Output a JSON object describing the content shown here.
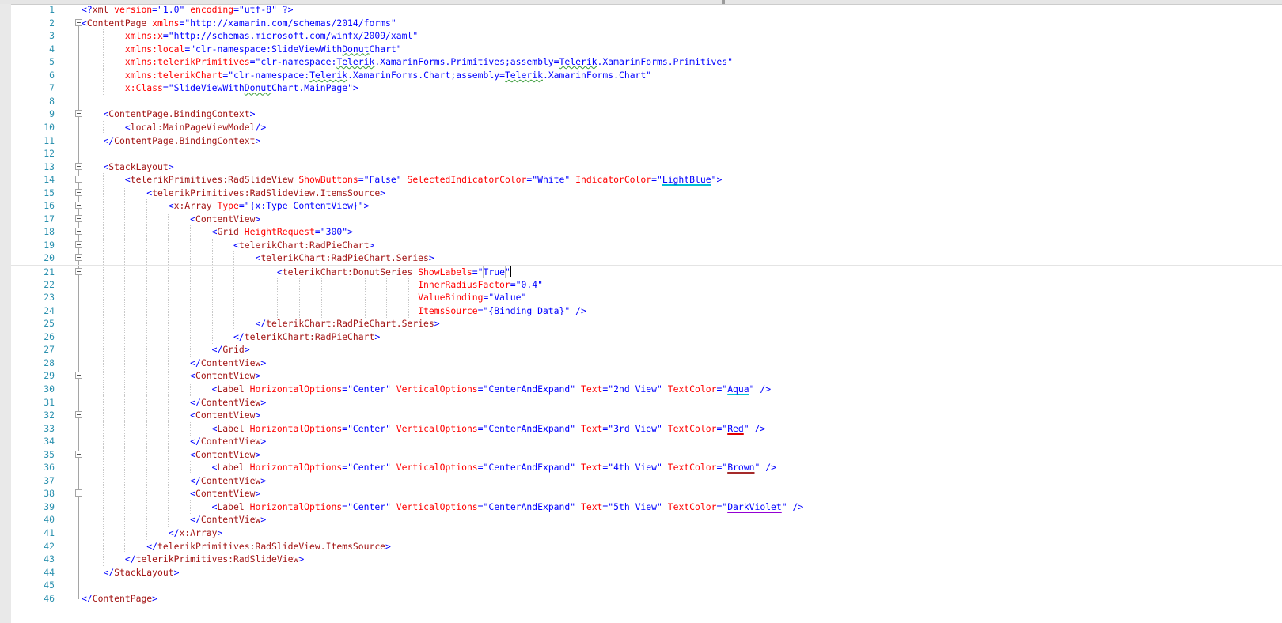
{
  "editor": {
    "line_numbers": [
      "1",
      "2",
      "3",
      "4",
      "5",
      "6",
      "7",
      "8",
      "9",
      "10",
      "11",
      "12",
      "13",
      "14",
      "15",
      "16",
      "17",
      "18",
      "19",
      "20",
      "21",
      "22",
      "23",
      "24",
      "25",
      "26",
      "27",
      "28",
      "29",
      "30",
      "31",
      "32",
      "33",
      "34",
      "35",
      "36",
      "37",
      "38",
      "39",
      "40",
      "41",
      "42",
      "43",
      "44",
      "45",
      "46"
    ],
    "lines": [
      "<?xml version=\"1.0\" encoding=\"utf-8\" ?>",
      "<ContentPage xmlns=\"http://xamarin.com/schemas/2014/forms\"",
      "        xmlns:x=\"http://schemas.microsoft.com/winfx/2009/xaml\"",
      "        xmlns:local=\"clr-namespace:SlideViewWithDonutChart\"",
      "        xmlns:telerikPrimitives=\"clr-namespace:Telerik.XamarinForms.Primitives;assembly=Telerik.XamarinForms.Primitives\"",
      "        xmlns:telerikChart=\"clr-namespace:Telerik.XamarinForms.Chart;assembly=Telerik.XamarinForms.Chart\"",
      "        x:Class=\"SlideViewWithDonutChart.MainPage\">",
      "",
      "    <ContentPage.BindingContext>",
      "        <local:MainPageViewModel/>",
      "    </ContentPage.BindingContext>",
      "",
      "    <StackLayout>",
      "        <telerikPrimitives:RadSlideView ShowButtons=\"False\" SelectedIndicatorColor=\"White\" IndicatorColor=\"LightBlue\">",
      "            <telerikPrimitives:RadSlideView.ItemsSource>",
      "                <x:Array Type=\"{x:Type ContentView}\">",
      "                    <ContentView>",
      "                        <Grid HeightRequest=\"300\">",
      "                            <telerikChart:RadPieChart>",
      "                                <telerikChart:RadPieChart.Series>",
      "                                    <telerikChart:DonutSeries ShowLabels=\"True\"",
      "                                                              InnerRadiusFactor=\"0.4\"",
      "                                                              ValueBinding=\"Value\"",
      "                                                              ItemsSource=\"{Binding Data}\" />",
      "                                </telerikChart:RadPieChart.Series>",
      "                            </telerikChart:RadPieChart>",
      "                        </Grid>",
      "                    </ContentView>",
      "                    <ContentView>",
      "                        <Label HorizontalOptions=\"Center\" VerticalOptions=\"CenterAndExpand\" Text=\"2nd View\" TextColor=\"Aqua\" />",
      "                    </ContentView>",
      "                    <ContentView>",
      "                        <Label HorizontalOptions=\"Center\" VerticalOptions=\"CenterAndExpand\" Text=\"3rd View\" TextColor=\"Red\" />",
      "                    </ContentView>",
      "                    <ContentView>",
      "                        <Label HorizontalOptions=\"Center\" VerticalOptions=\"CenterAndExpand\" Text=\"4th View\" TextColor=\"Brown\" />",
      "                    </ContentView>",
      "                    <ContentView>",
      "                        <Label HorizontalOptions=\"Center\" VerticalOptions=\"CenterAndExpand\" Text=\"5th View\" TextColor=\"DarkViolet\" />",
      "                    </ContentView>",
      "                </x:Array>",
      "            </telerikPrimitives:RadSlideView.ItemsSource>",
      "        </telerikPrimitives:RadSlideView>",
      "    </StackLayout>",
      "",
      "</ContentPage>"
    ],
    "colors": {
      "line_number": "#2b91af",
      "element": "#a31515",
      "attribute": "#ff0000",
      "value": "#0000ff",
      "aqua_underline": "#00bcd4",
      "red_underline": "#e00000",
      "brown_underline": "#a52a2a",
      "darkviolet_underline": "#9400d3"
    },
    "icons": {
      "fold": "collapse-minus-icon"
    }
  }
}
